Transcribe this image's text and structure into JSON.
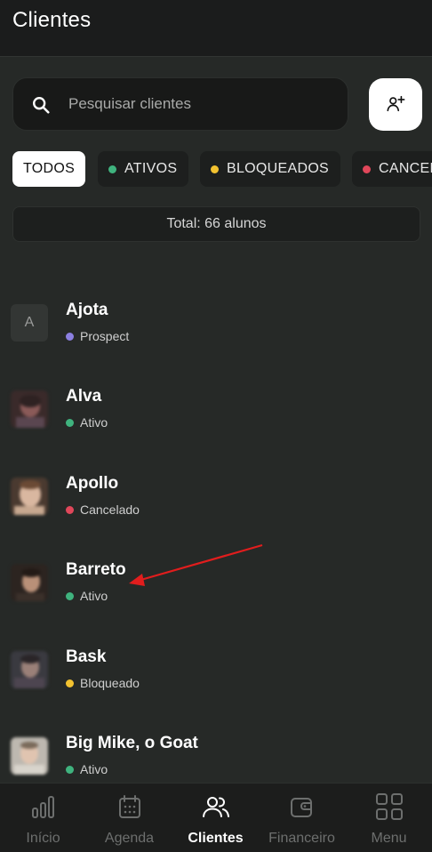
{
  "header": {
    "title": "Clientes"
  },
  "search": {
    "placeholder": "Pesquisar clientes"
  },
  "filters": [
    {
      "label": "TODOS",
      "active": true,
      "dot_color": ""
    },
    {
      "label": "ATIVOS",
      "active": false,
      "dot_color": "#3fb37e"
    },
    {
      "label": "BLOQUEADOS",
      "active": false,
      "dot_color": "#f2c230"
    },
    {
      "label": "CANCELADOS",
      "active": false,
      "dot_color": "#e0475a"
    }
  ],
  "summary": {
    "total_text": "Total: 66 alunos"
  },
  "clients": [
    {
      "name": "Ajota",
      "status": "Prospect",
      "status_color": "#8b7fe0",
      "avatar_letter": "A",
      "has_photo": false
    },
    {
      "name": "Alva",
      "status": "Ativo",
      "status_color": "#3fb37e",
      "avatar_letter": "",
      "has_photo": true
    },
    {
      "name": "Apollo",
      "status": "Cancelado",
      "status_color": "#e0475a",
      "avatar_letter": "",
      "has_photo": true
    },
    {
      "name": "Barreto",
      "status": "Ativo",
      "status_color": "#3fb37e",
      "avatar_letter": "",
      "has_photo": true
    },
    {
      "name": "Bask",
      "status": "Bloqueado",
      "status_color": "#f2c230",
      "avatar_letter": "",
      "has_photo": true
    },
    {
      "name": "Big Mike, o Goat",
      "status": "Ativo",
      "status_color": "#3fb37e",
      "avatar_letter": "",
      "has_photo": true
    }
  ],
  "nav": {
    "items": [
      {
        "label": "Início",
        "icon": "bar-chart-icon",
        "active": false
      },
      {
        "label": "Agenda",
        "icon": "calendar-icon",
        "active": false
      },
      {
        "label": "Clientes",
        "icon": "users-icon",
        "active": true
      },
      {
        "label": "Financeiro",
        "icon": "wallet-icon",
        "active": false
      },
      {
        "label": "Menu",
        "icon": "grid-icon",
        "active": false
      }
    ]
  },
  "annotation": {
    "arrow_color": "#e11d1d"
  }
}
